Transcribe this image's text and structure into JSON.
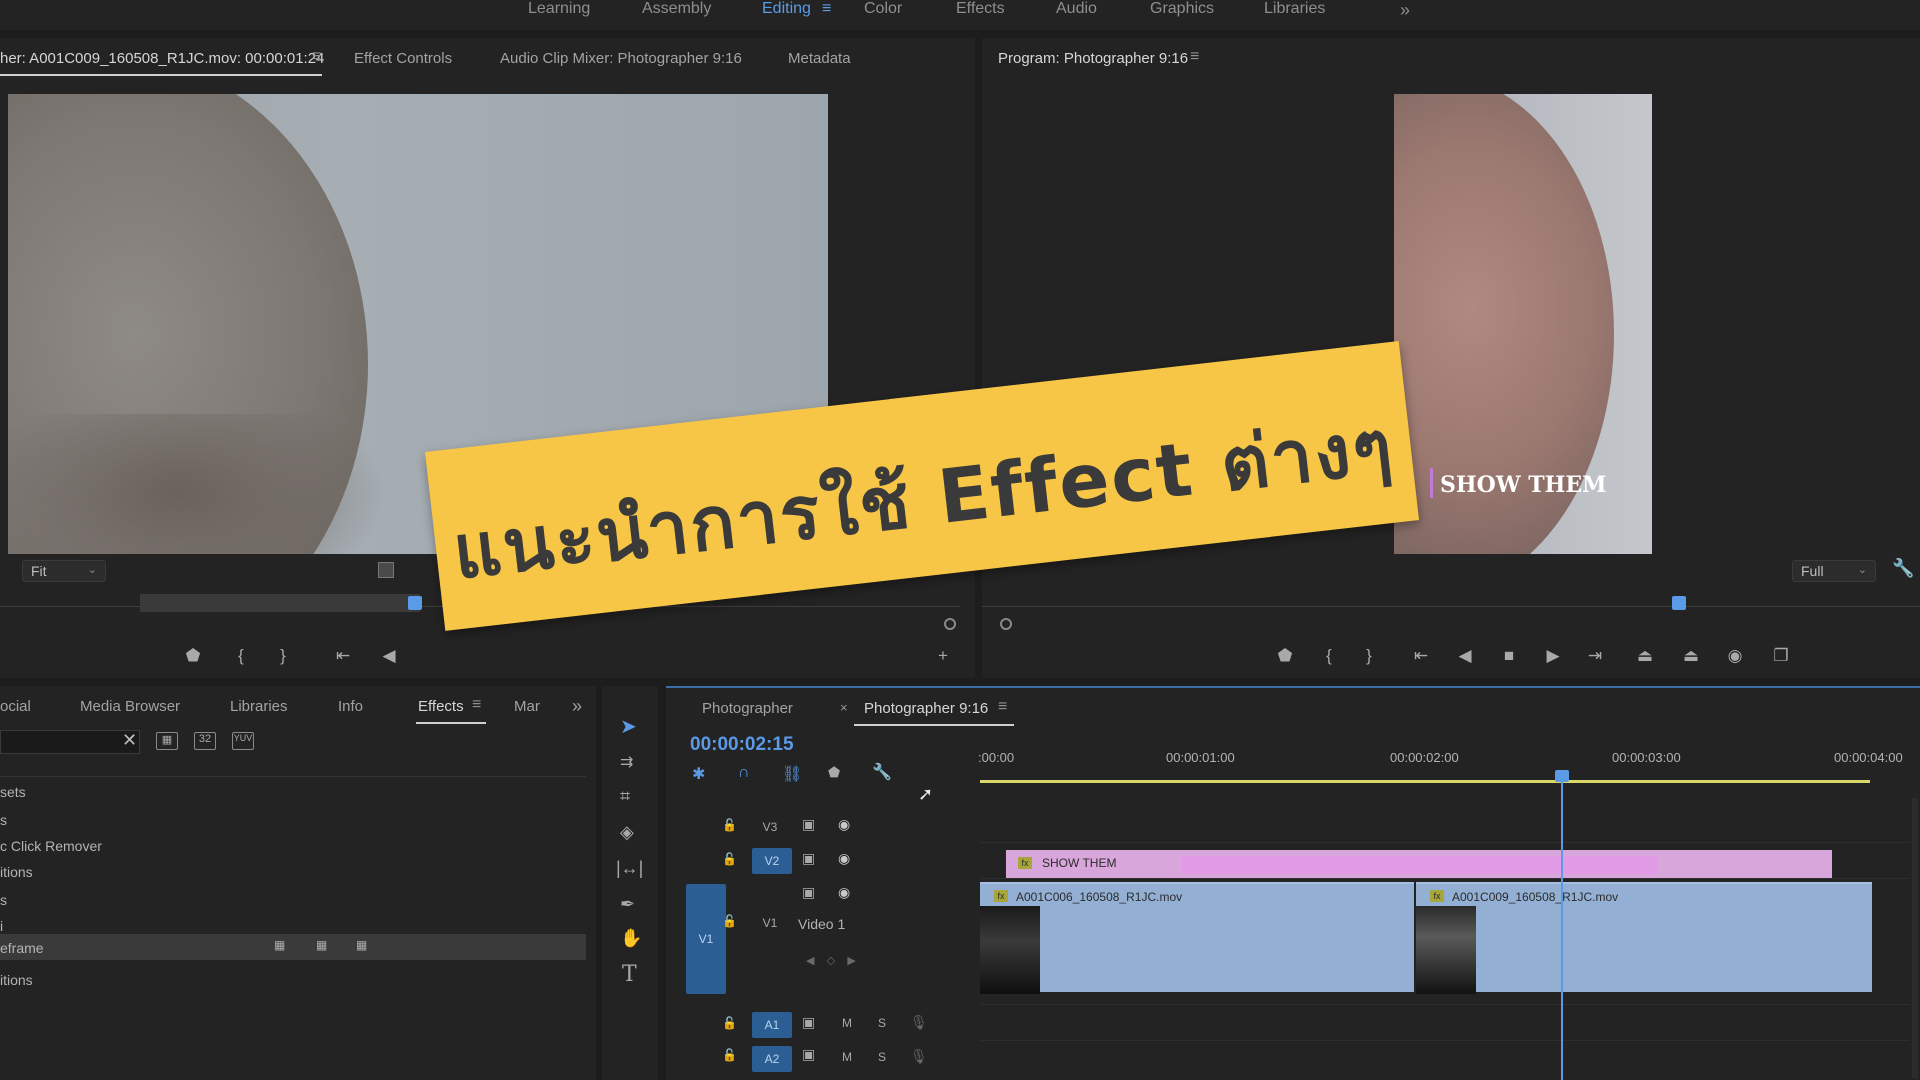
{
  "workspace": {
    "tabs": [
      "Learning",
      "Assembly",
      "Editing",
      "Color",
      "Effects",
      "Audio",
      "Graphics",
      "Libraries"
    ],
    "active": "Editing",
    "more": "»"
  },
  "source_panel": {
    "tabs": [
      "her: A001C009_160508_R1JC.mov: 00:00:01:24",
      "Effect Controls",
      "Audio Clip Mixer: Photographer 9:16",
      "Metadata"
    ],
    "menu_icon": "≡",
    "zoom": "Fit"
  },
  "program_panel": {
    "title": "Program: Photographer 9:16",
    "menu_icon": "≡",
    "overlay_text": "SHOW THEM",
    "zoom": "Full"
  },
  "effects_panel": {
    "tabs": [
      "ocial",
      "Media Browser",
      "Libraries",
      "Info",
      "Effects",
      "Mar"
    ],
    "active": "Effects",
    "more": "»",
    "list": [
      "sets",
      "s",
      "c Click Remover",
      "itions",
      "s",
      "i",
      "eframe",
      "itions"
    ]
  },
  "timeline": {
    "tabs": [
      "Photographer",
      "Photographer 9:16"
    ],
    "close": "×",
    "menu_icon": "≡",
    "timecode": "00:00:02:15",
    "ruler": [
      ":00:00",
      "00:00:01:00",
      "00:00:02:00",
      "00:00:03:00",
      "00:00:04:00"
    ],
    "tracks": {
      "v3": "V3",
      "v2": "V2",
      "v1": "V1",
      "v1_name": "Video 1",
      "a1": "A1",
      "a2": "A2",
      "mute": "M",
      "solo": "S"
    },
    "clips": {
      "title": "SHOW THEM",
      "video1": "A001C006_160508_R1JC.mov",
      "video2": "A001C009_160508_R1JC.mov",
      "fx": "fx"
    }
  },
  "banner": {
    "text": "แนะนำการใช้ Effect ต่างๆ"
  },
  "colors": {
    "accent_blue": "#5a9ae6",
    "banner_yellow": "#f8c646",
    "clip_blue": "#93b0d4",
    "clip_pink": "#d9a6dc",
    "playhead": "#5a9ae6",
    "work_area": "#d9d96a"
  }
}
